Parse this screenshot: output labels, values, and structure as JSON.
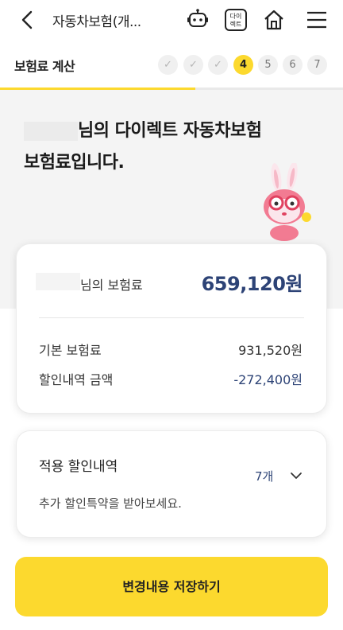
{
  "header": {
    "title": "자동차보험(개...",
    "icons": [
      "back-icon",
      "chatbot-icon",
      "direct-badge-icon",
      "home-icon",
      "menu-icon"
    ],
    "direct_badge_line1": "다이",
    "direct_badge_line2": "렉트"
  },
  "steps": {
    "title": "보험료 계산",
    "current": 4,
    "items": [
      "✓",
      "✓",
      "✓",
      "4",
      "5",
      "6",
      "7"
    ],
    "progress_fraction": 0.57
  },
  "hero": {
    "line1": "님의 다이렉트 자동차보험",
    "line2": "보험료입니다."
  },
  "premium": {
    "label": "님의 보험료",
    "total": "659,120원",
    "base_label": "기본 보험료",
    "base_value": "931,520원",
    "discount_label": "할인내역 금액",
    "discount_value": "-272,400원"
  },
  "discounts": {
    "title": "적용 할인내역",
    "count": "7개",
    "subtitle": "추가 할인특약을 받아보세요."
  },
  "save_button": "변경내용 저장하기",
  "colors": {
    "accent_yellow": "#fcd92e",
    "navy": "#2d4376"
  }
}
